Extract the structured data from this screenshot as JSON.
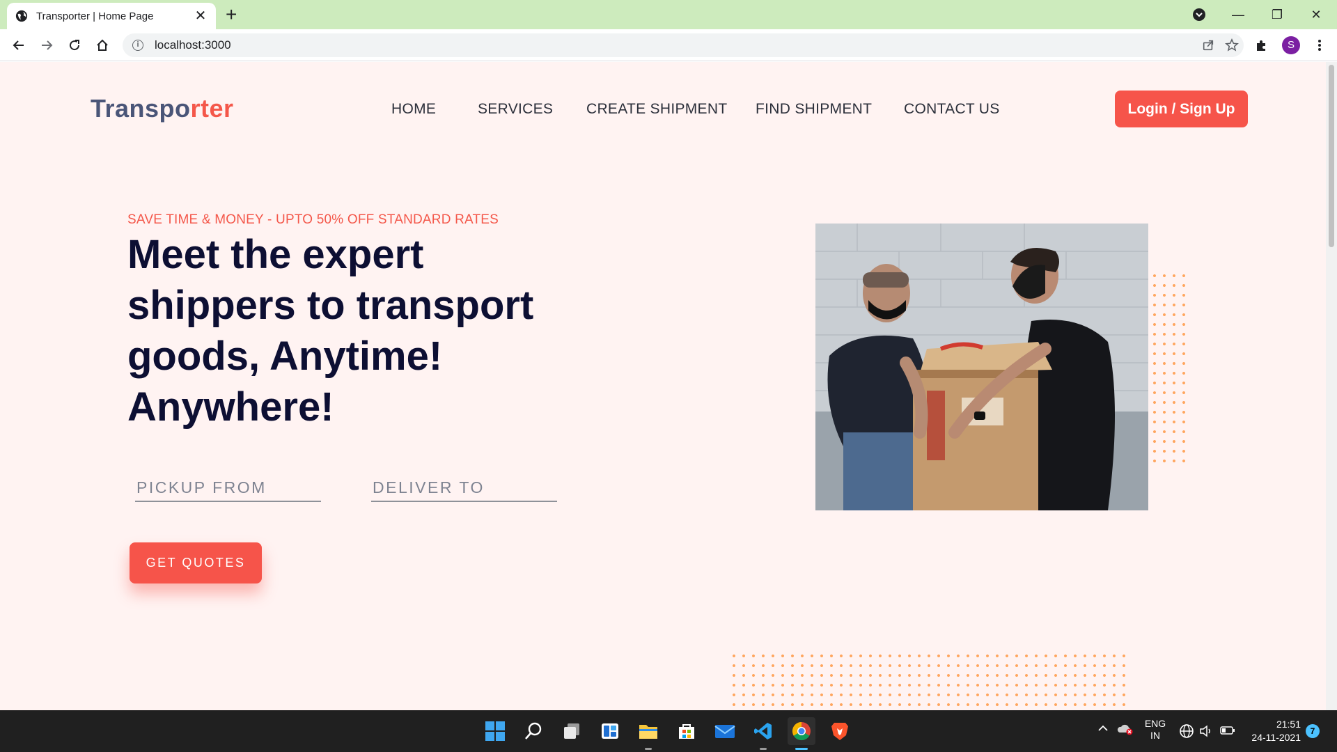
{
  "browser": {
    "tab_title": "Transporter | Home Page",
    "tab_close": "✕",
    "new_tab": "+",
    "url": "localhost:3000",
    "window_controls": [
      "—",
      "❐",
      "✕"
    ],
    "profile_initial": "S",
    "tabbar_color": "#cdebbd"
  },
  "site": {
    "logo_part1": "Transpo",
    "logo_part2": "rter",
    "nav": [
      "HOME",
      "SERVICES",
      "CREATE SHIPMENT",
      "FIND SHIPMENT",
      "CONTACT US"
    ],
    "login_label": "Login / Sign Up",
    "accent_color": "#f6544a",
    "page_bg": "#fff3f2"
  },
  "hero": {
    "tagline": "SAVE TIME & MONEY - UPTO 50% OFF STANDARD RATES",
    "headline": "Meet the expert shippers to transport goods, Anytime! Anywhere!",
    "pickup_placeholder": "PICKUP FROM",
    "deliver_placeholder": "DELIVER TO",
    "cta_label": "GET QUOTES",
    "image_alt": "Two men in masks lifting cardboard boxes"
  },
  "taskbar": {
    "apps": [
      "windows-start",
      "search",
      "task-view",
      "widgets",
      "file-explorer",
      "microsoft-store",
      "mail",
      "vs-code",
      "chrome",
      "brave"
    ],
    "lang_line1": "ENG",
    "lang_line2": "IN",
    "time": "21:51",
    "date": "24-11-2021",
    "notification_count": "7"
  }
}
